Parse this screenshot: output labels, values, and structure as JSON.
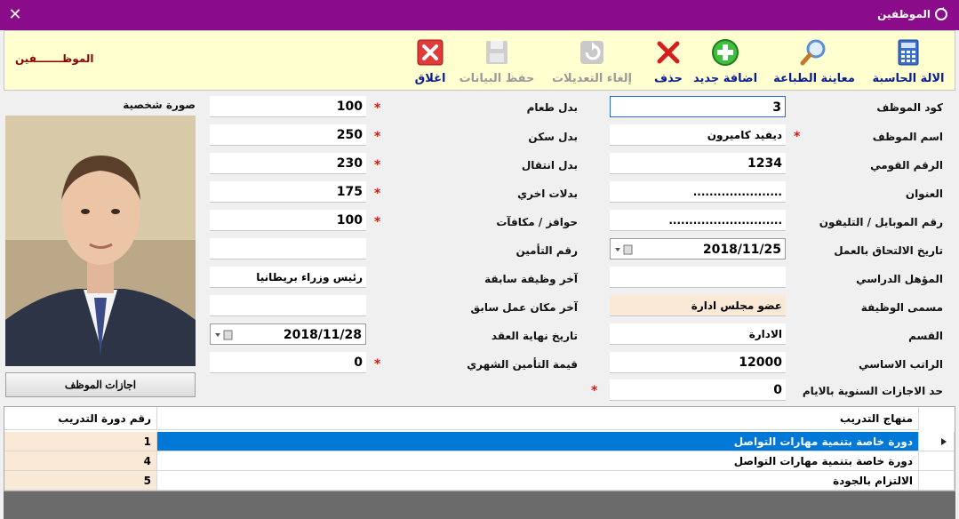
{
  "window": {
    "title": "الموظفين"
  },
  "toolbar": {
    "calculator": "الالة الحاسبة",
    "print_preview": "معاينة الطباعة",
    "add_new": "اضافة جديد",
    "delete": "حذف",
    "cancel_edits": "إلغاء التعديلات",
    "save_data": "حفظ البيانات",
    "close": "اغلاق",
    "brand": "الموظـــــــفين"
  },
  "right_fields": {
    "emp_code": {
      "label": "كود الموظف",
      "value": "3"
    },
    "emp_name": {
      "label": "اسم الموظف",
      "value": "ديفيد كاميرون"
    },
    "national_id": {
      "label": "الرقم القومي",
      "value": "1234"
    },
    "address": {
      "label": "العنوان",
      "value": "......................"
    },
    "phone": {
      "label": "رقم الموبايل / التليفون",
      "value": "............................"
    },
    "join_date": {
      "label": "تاريخ الالتحاق بالعمل",
      "value": "2018/11/25"
    },
    "qualification": {
      "label": "المؤهل الدراسي",
      "value": ""
    },
    "job_title": {
      "label": "مسمى الوظيفة",
      "value": "عضو مجلس ادارة"
    },
    "department": {
      "label": "القسم",
      "value": "الادارة"
    },
    "basic_salary": {
      "label": "الراتب الاساسي",
      "value": "12000"
    },
    "annual_leave": {
      "label": "حد الاجازات السنوية بالايام",
      "value": "0"
    }
  },
  "mid_fields": {
    "food_allowance": {
      "label": "بدل طعام",
      "value": "100"
    },
    "housing_allowance": {
      "label": "بدل سكن",
      "value": "250"
    },
    "transport_allowance": {
      "label": "بدل انتقال",
      "value": "230"
    },
    "other_allowances": {
      "label": "بدلات اخري",
      "value": "175"
    },
    "bonuses": {
      "label": "حوافز / مكافآت",
      "value": "100"
    },
    "insurance_no": {
      "label": "رقم التأمين",
      "value": ""
    },
    "last_job": {
      "label": "آخر وظيفة سابقة",
      "value": "رئيس وزراء بريطانيا"
    },
    "last_workplace": {
      "label": "آخر مكان عمل سابق",
      "value": ""
    },
    "contract_end": {
      "label": "تاريخ نهاية العقد",
      "value": "2018/11/28"
    },
    "monthly_insurance": {
      "label": "قيمة التأمين الشهري",
      "value": "0"
    }
  },
  "photo": {
    "label": "صورة شخصية"
  },
  "leave_button": "اجازات الموظف",
  "grid": {
    "headers": {
      "program": "منهاج التدريب",
      "course_no": "رقم دورة التدريب"
    },
    "rows": [
      {
        "program": "دورة خاصة بتنمية مهارات التواصل",
        "course_no": "1",
        "selected": true
      },
      {
        "program": "دورة خاصة بتنمية مهارات التواصل",
        "course_no": "4",
        "selected": false
      },
      {
        "program": "الالتزام بالجودة",
        "course_no": "5",
        "selected": false
      }
    ]
  },
  "colors": {
    "titlebar": "#8b0c8b",
    "toolbar_bg": "#ffffd0",
    "selected_row": "#0078d7",
    "peach": "#fbe9d8"
  }
}
